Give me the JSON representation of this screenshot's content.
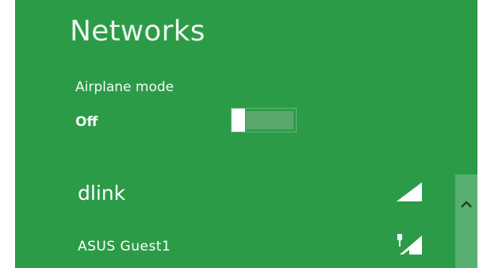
{
  "panel": {
    "title": "Networks",
    "background": "#2c9b48"
  },
  "airplane_mode": {
    "label": "Airplane mode",
    "state": "Off",
    "on": false
  },
  "networks": [
    {
      "name": "dlink",
      "signal_icon": "wifi-signal-icon",
      "secured": false
    },
    {
      "name": "ASUS Guest1",
      "signal_icon": "wifi-signal-secured-icon",
      "secured": true
    }
  ],
  "scrollbar": {
    "arrow_icon": "chevron-up-icon"
  }
}
